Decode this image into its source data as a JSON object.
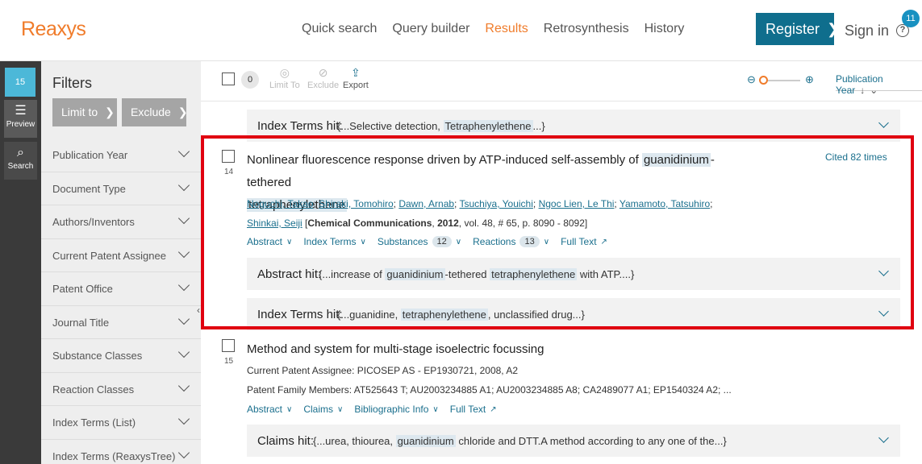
{
  "header": {
    "logo": "Reaxys",
    "nav": [
      {
        "label": "Quick search",
        "active": false
      },
      {
        "label": "Query builder",
        "active": false
      },
      {
        "label": "Results",
        "active": true
      },
      {
        "label": "Retrosynthesis",
        "active": false
      },
      {
        "label": "History",
        "active": false
      }
    ],
    "register_label": "Register",
    "signin_label": "Sign in",
    "help_badge": "11",
    "help_icon": "?",
    "accent_color": "#f07c2b",
    "brand_color": "#0f6e8d"
  },
  "rail": {
    "count": "15",
    "preview_label": "Preview",
    "search_label": "Search"
  },
  "filters": {
    "title": "Filters",
    "limit_to_label": "Limit to",
    "exclude_label": "Exclude",
    "items": [
      "Publication Year",
      "Document Type",
      "Authors/Inventors",
      "Current Patent Assignee",
      "Patent Office",
      "Journal Title",
      "Substance Classes",
      "Reaction Classes",
      "Index Terms (List)",
      "Index Terms (ReaxysTree)"
    ]
  },
  "toolbar": {
    "selected_count": "0",
    "limit_to": "Limit To",
    "exclude": "Exclude",
    "export": "Export",
    "sort_label": "Publication Year"
  },
  "results": {
    "prev_hit": {
      "label": "Index Terms hit:",
      "pre": "{...Selective detection, ",
      "term": "Tetraphenylethene",
      "post": "...}"
    },
    "rec14": {
      "number": "14",
      "title_pre": "Nonlinear fluorescence response driven by ATP-induced self-assembly of ",
      "title_hl1": "guanidinium",
      "title_mid": "-tethered",
      "title_hl2": "tetraphenylethene",
      "authors": [
        "Noguchi, Takao",
        "Shiraki, Tomohiro",
        "Dawn, Arnab",
        "Tsuchiya, Youichi",
        "Ngoc Lien, Le Thi",
        "Yamamoto, Tatsuhiro",
        "Shinkai, Seiji"
      ],
      "journal": "Chemical Communications",
      "year": "2012",
      "citation_rest": ", vol. 48, # 65, p. 8090 - 8092]",
      "cited": "Cited 82 times",
      "links": {
        "abstract": "Abstract",
        "index_terms": "Index Terms",
        "substances": "Substances",
        "substances_count": "12",
        "reactions": "Reactions",
        "reactions_count": "13",
        "full_text": "Full Text"
      },
      "abstract_hit": {
        "label": "Abstract hit:",
        "pre": "{...increase of ",
        "hl1": "guanidinium",
        "mid": "-tethered ",
        "hl2": "tetraphenylethene",
        "post": " with ATP....}"
      },
      "index_hit": {
        "label": "Index Terms hit:",
        "pre": "{...guanidine, ",
        "hl": "tetraphenylethene",
        "post": ", unclassified drug...}"
      }
    },
    "rec15": {
      "number": "15",
      "title": "Method and system for multi-stage isoelectric focussing",
      "assignee": "Current Patent Assignee: PICOSEP AS - EP1930721, 2008, A2",
      "family": "Patent Family Members: AT525643 T; AU2003234885 A1; AU2003234885 A8; CA2489077 A1; EP1540324 A2; ...",
      "links": {
        "abstract": "Abstract",
        "claims": "Claims",
        "biblio": "Bibliographic Info",
        "full_text": "Full Text"
      },
      "claims_hit": {
        "label": "Claims hit:",
        "pre": "{...urea, thiourea, ",
        "hl": "guanidinium",
        "post": " chloride and DTT.A method according to any one of the...}"
      }
    }
  }
}
